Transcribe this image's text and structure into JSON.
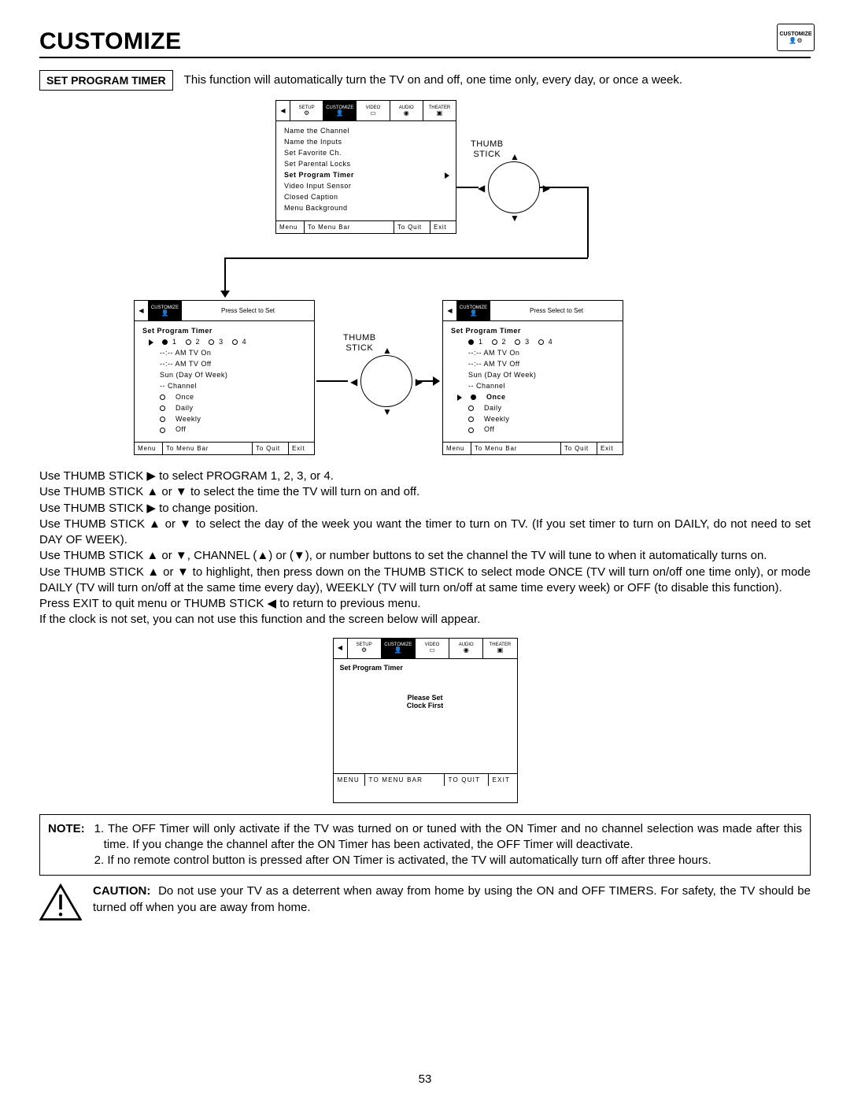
{
  "header": {
    "title": "CUSTOMIZE",
    "corner_icon_label": "CUSTOMIZE"
  },
  "section": {
    "label": "SET PROGRAM TIMER",
    "description": "This function will automatically turn the TV on and off, one time only, every day, or once a week."
  },
  "tabs": {
    "setup": "SETUP",
    "customize": "CUSTOMIZE",
    "video": "VIDEO",
    "audio": "AUDIO",
    "theater": "THEATER"
  },
  "menu1": {
    "items": [
      "Name the Channel",
      "Name the Inputs",
      "Set Favorite Ch.",
      "Set Parental Locks",
      "Set Program Timer",
      "Video Input Sensor",
      "Closed Caption",
      "Menu Background"
    ],
    "highlight_index": 4
  },
  "thumb_label": "THUMB\nSTICK",
  "submenu_header": "Press Select to Set",
  "submenu_title": "Set Program Timer",
  "submenu_programs": [
    "1",
    "2",
    "3",
    "4"
  ],
  "submenu_left": {
    "lines": [
      "--:-- AM TV On",
      "--:-- AM TV Off",
      "Sun (Day Of Week)",
      "-- Channel"
    ],
    "modes": [
      "Once",
      "Daily",
      "Weekly",
      "Off"
    ],
    "selected_program_index": 0,
    "mode_selected_index": -1,
    "arrow_at": "programs"
  },
  "submenu_right": {
    "lines": [
      "--:-- AM TV On",
      "--:-- AM TV Off",
      "Sun (Day Of Week)",
      "-- Channel"
    ],
    "modes": [
      "Once",
      "Daily",
      "Weekly",
      "Off"
    ],
    "selected_program_index": 0,
    "mode_selected_index": 0,
    "mode_bold": "Once",
    "arrow_at": "mode"
  },
  "footer": {
    "menu": "Menu",
    "tomenu": "To Menu Bar",
    "toquit": "To Quit",
    "exit": "Exit"
  },
  "body": {
    "p1": "Use THUMB STICK ▶ to select PROGRAM 1, 2, 3, or 4.",
    "p2": "Use THUMB STICK ▲ or ▼ to select the time the TV will turn on and off.",
    "p3": "Use THUMB STICK ▶ to change position.",
    "p4": "Use THUMB STICK ▲ or ▼ to select the day of the week you want the timer to turn on TV. (If you set timer to turn on DAILY, do not need to set DAY OF WEEK).",
    "p5": "Use THUMB STICK ▲ or ▼, CHANNEL (▲) or (▼), or number buttons to set the channel the TV will tune to when it automatically turns on.",
    "p6": "Use THUMB STICK ▲ or ▼ to highlight, then press down on the THUMB STICK to select mode ONCE (TV will turn on/off one time only), or mode DAILY (TV will turn on/off at the same time every day), WEEKLY (TV will turn on/off at same time every week) or OFF (to disable this function).",
    "p7": "Press EXIT to quit menu or THUMB STICK ◀  to return to previous menu.",
    "p8": "If the clock is not set, you can not use this function and the screen below will appear."
  },
  "clock_screen": {
    "title": "Set Program Timer",
    "msg_l1": "Please Set",
    "msg_l2": "Clock First",
    "foot": {
      "menu": "MENU",
      "tomenu": "TO MENU BAR",
      "toquit": "TO QUIT",
      "exit": "EXIT"
    }
  },
  "note": {
    "label": "NOTE:",
    "n1": "1. The OFF Timer will only activate if the TV was turned on or tuned with the ON Timer and no channel selection was made after this time.  If you change the channel after the ON Timer has been activated, the OFF Timer will deactivate.",
    "n2": "2. If no remote control button is pressed after ON Timer is activated, the TV will automatically turn off after three hours."
  },
  "caution": {
    "label": "CAUTION:",
    "text": "Do not use your TV as a deterrent when away from home by using the ON and OFF TIMERS.  For safety, the TV should be turned off when you are away from home."
  },
  "page_number": "53"
}
